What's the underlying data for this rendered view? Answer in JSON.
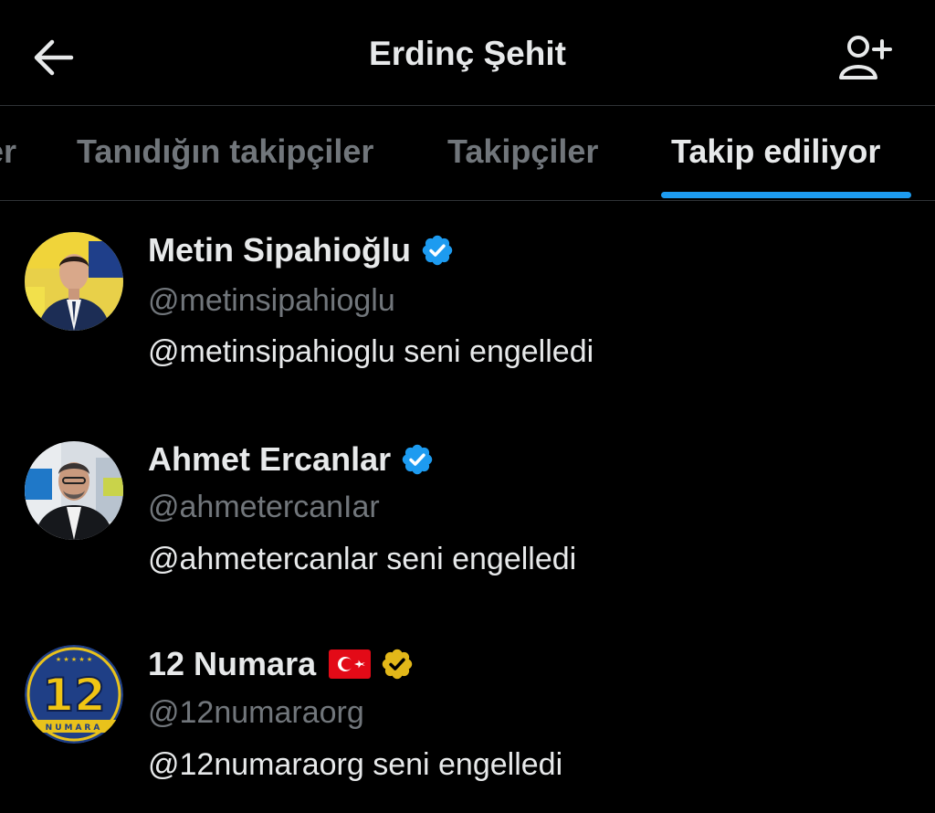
{
  "header": {
    "title": "Erdinç Şehit",
    "back_icon": "arrow-left-icon",
    "add_icon": "add-person-icon"
  },
  "tabs": [
    {
      "label": "er",
      "active": false
    },
    {
      "label": "Tanıdığın takipçiler",
      "active": false
    },
    {
      "label": "Takipçiler",
      "active": false
    },
    {
      "label": "Takip ediliyor",
      "active": true
    }
  ],
  "colors": {
    "background": "#000000",
    "text_primary": "#e7e9ea",
    "text_secondary": "#71767b",
    "accent": "#1d9bf0",
    "verified_blue": "#1d9bf0",
    "verified_gold": "#e2b719"
  },
  "users": [
    {
      "name": "Metin Sipahioğlu",
      "verified": "blue",
      "handle": "@metinsipahioglu",
      "status": "@metinsipahioglu seni engelledi"
    },
    {
      "name": "Ahmet Ercanlar",
      "verified": "blue",
      "handle": "@ahmetercanIar",
      "status": "@ahmetercanlar seni engelledi"
    },
    {
      "name": "12 Numara",
      "flag": "turkey-flag-icon",
      "verified": "gold",
      "handle": "@12numaraorg",
      "status": "@12numaraorg seni engelledi",
      "avatar_text": "12",
      "avatar_subtext": "NUMARA"
    }
  ]
}
